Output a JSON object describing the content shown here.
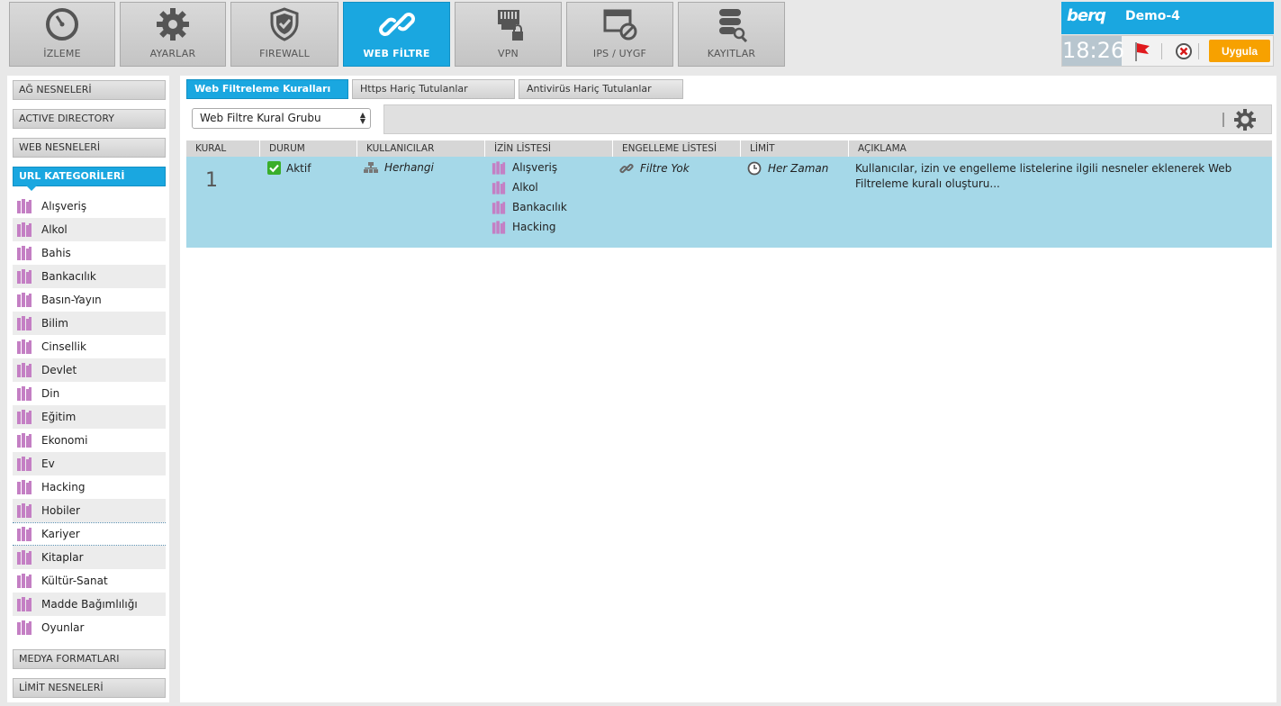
{
  "nav": {
    "items": [
      {
        "label": "İZLEME",
        "icon": "gauge-icon"
      },
      {
        "label": "AYARLAR",
        "icon": "gear-icon"
      },
      {
        "label": "FIREWALL",
        "icon": "shield-icon"
      },
      {
        "label": "WEB FİLTRE",
        "icon": "link-icon",
        "active": true
      },
      {
        "label": "VPN",
        "icon": "network-lock-icon"
      },
      {
        "label": "IPS / UYGF",
        "icon": "blocked-window-icon"
      },
      {
        "label": "KAYITLAR",
        "icon": "database-search-icon"
      }
    ]
  },
  "brand": {
    "logo": "berq",
    "device_name": "Demo-4",
    "time": "18:26",
    "apply_label": "Uygula",
    "accent_color": "#1aa7e0",
    "apply_color": "#f7a100"
  },
  "sidebar": {
    "sections_top": [
      "AĞ NESNELERİ",
      "ACTIVE DIRECTORY",
      "WEB NESNELERİ"
    ],
    "active_section": "URL KATEGORİLERİ",
    "categories": [
      "Alışveriş",
      "Alkol",
      "Bahis",
      "Bankacılık",
      "Basın-Yayın",
      "Bilim",
      "Cinsellik",
      "Devlet",
      "Din",
      "Eğitim",
      "Ekonomi",
      "Ev",
      "Hacking",
      "Hobiler",
      "Kariyer",
      "Kitaplar",
      "Kültür-Sanat",
      "Madde Bağımlılığı",
      "Oyunlar"
    ],
    "sections_bottom": [
      "MEDYA FORMATLARI",
      "LİMİT NESNELERİ"
    ]
  },
  "main": {
    "tabs": [
      "Web Filtreleme Kuralları",
      "Https Hariç Tutulanlar",
      "Antivirüs Hariç Tutulanlar"
    ],
    "group_select": "Web Filtre Kural Grubu",
    "columns": [
      "KURAL",
      "DURUM",
      "KULLANICILAR",
      "İZİN LİSTESİ",
      "ENGELLEME LİSTESİ",
      "LİMİT",
      "AÇIKLAMA"
    ],
    "rows": [
      {
        "rule": "1",
        "status": "Aktif",
        "users": "Herhangi",
        "allow_list": [
          "Alışveriş",
          "Alkol",
          "Bankacılık",
          "Hacking"
        ],
        "block_list": "Filtre Yok",
        "limit": "Her Zaman",
        "description": "Kullanıcılar, izin ve engelleme listelerine ilgili nesneler eklenerek Web Filtreleme kuralı oluşturu..."
      }
    ]
  }
}
